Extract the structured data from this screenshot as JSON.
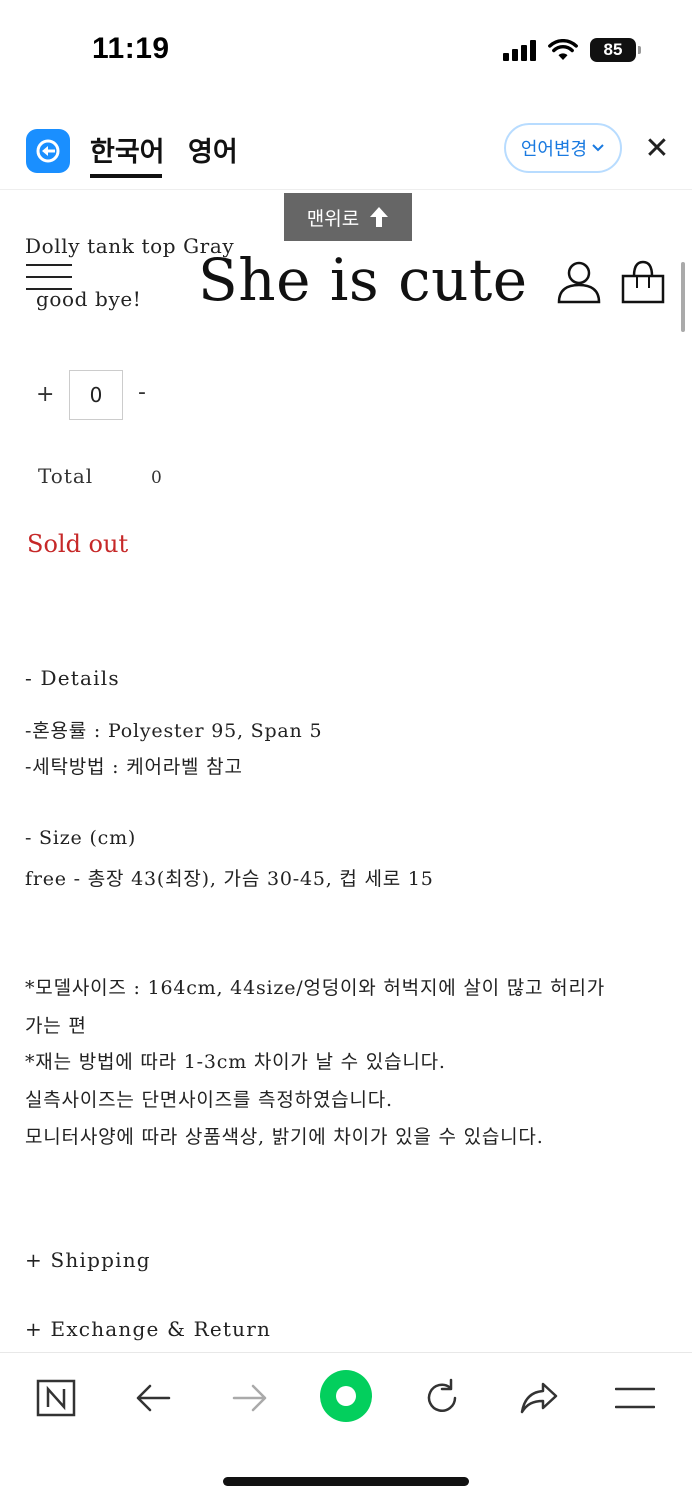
{
  "status_bar": {
    "time": "11:19",
    "battery": "85"
  },
  "translate_bar": {
    "tabs": [
      "한국어",
      "영어"
    ],
    "language_change": "언어변경"
  },
  "header": {
    "to_top": "맨위로",
    "product_name": "Dolly tank top Gray",
    "goodbye": "good bye!",
    "logo": "She is cute"
  },
  "quantity": {
    "plus": "+",
    "value": "0",
    "minus": "-"
  },
  "total": {
    "label": "Total",
    "value": "0"
  },
  "sold_out": "Sold out",
  "details": {
    "title": "- Details",
    "material": "-혼용률 : Polyester 95, Span 5",
    "washing": "-세탁방법 : 케어라벨 참고",
    "size_title": "- Size (cm)",
    "size": "free - 총장 43(최장), 가슴 30-45, 컵 세로 15",
    "notes": [
      "*모델사이즈 : 164cm, 44size/엉덩이와 허벅지에 살이 많고 허리가",
      "가는 편",
      "*재는 방법에 따라 1-3cm 차이가 날 수 있습니다.",
      "실측사이즈는 단면사이즈를 측정하였습니다.",
      "모니터사양에 따라 상품색상, 밝기에 차이가 있을 수 있습니다."
    ],
    "shipping": "+ Shipping",
    "exchange": "+ Exchange & Return"
  },
  "colors": {
    "accent_blue": "#1a8fff",
    "sold_out_red": "#c62828",
    "naver_green": "#03cf5d"
  },
  "toolbar_icons": [
    "naver-n-icon",
    "back-arrow-icon",
    "forward-arrow-icon",
    "green-dot-icon",
    "reload-icon",
    "share-icon",
    "menu-icon"
  ]
}
